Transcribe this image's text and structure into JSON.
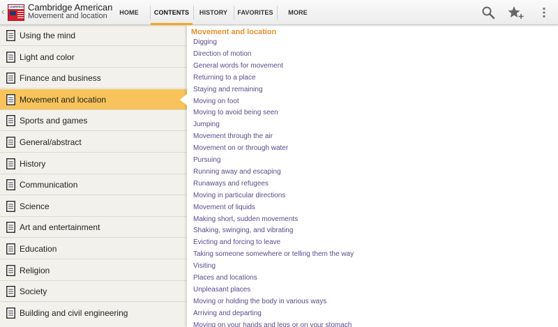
{
  "app": {
    "title": "Cambridge American",
    "subtitle": "Movement and location",
    "logo_text": "CAMBRIDGE"
  },
  "tabs": [
    {
      "label": "HOME",
      "active": false
    },
    {
      "label": "CONTENTS",
      "active": true
    },
    {
      "label": "HISTORY",
      "active": false
    },
    {
      "label": "FAVORITES",
      "active": false
    },
    {
      "label": "MORE",
      "active": false
    }
  ],
  "actions": {
    "search_icon": "search-icon",
    "add_favorite_icon": "star-plus-icon",
    "overflow_icon": "overflow-menu-icon"
  },
  "sidebar": {
    "items": [
      {
        "label": "Using the mind"
      },
      {
        "label": "Light and color"
      },
      {
        "label": "Finance and business"
      },
      {
        "label": "Movement and location",
        "active": true
      },
      {
        "label": "Sports and games"
      },
      {
        "label": "General/abstract"
      },
      {
        "label": "History"
      },
      {
        "label": "Communication"
      },
      {
        "label": "Science"
      },
      {
        "label": "Art and entertainment"
      },
      {
        "label": "Education"
      },
      {
        "label": "Religion"
      },
      {
        "label": "Society"
      },
      {
        "label": "Building and civil engineering"
      }
    ]
  },
  "content": {
    "heading": "Movement and location",
    "links": [
      "Digging",
      "Direction of motion",
      "General words for movement",
      "Returning to a place",
      "Staying and remaining",
      "Moving on foot",
      "Moving to avoid being seen",
      "Jumping",
      "Movement through the air",
      "Movement on or through water",
      "Pursuing",
      "Running away and escaping",
      "Runaways and refugees",
      "Moving in particular directions",
      "Movement of liquids",
      "Making short, sudden movements",
      "Shaking, swinging, and vibrating",
      "Evicting and forcing to leave",
      "Taking someone somewhere or telling them the way",
      "Visiting",
      "Places and locations",
      "Unpleasant places",
      "Moving or holding the body in various ways",
      "Arriving and departing",
      "Moving on your hands and legs or on your stomach"
    ]
  },
  "colors": {
    "accent": "#f5a623",
    "active_row": "#f7c35a",
    "heading": "#e8902a",
    "link": "#5b4a8a"
  }
}
